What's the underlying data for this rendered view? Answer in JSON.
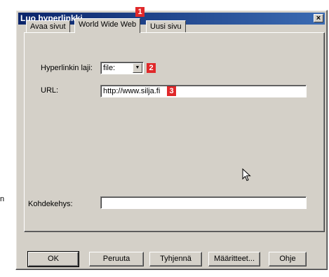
{
  "dialog": {
    "title": "Luo hyperlinkki",
    "close_glyph": "×"
  },
  "tabs": [
    {
      "label": "Avaa sivut",
      "active": false
    },
    {
      "label": "World Wide Web",
      "active": true
    },
    {
      "label": "Uusi sivu",
      "active": false
    }
  ],
  "form": {
    "hyperlink_type_label": "Hyperlinkin laji:",
    "hyperlink_type_value": "file:",
    "url_label": "URL:",
    "url_value": "http://www.silja.fi",
    "target_frame_label": "Kohdekehys:",
    "target_frame_value": ""
  },
  "callouts": [
    "1",
    "2",
    "3"
  ],
  "buttons": {
    "ok": "OK",
    "cancel": "Peruuta",
    "clear": "Tyhjennä",
    "properties": "Määritteet...",
    "help": "Ohje"
  },
  "edge_mark": "n",
  "colors": {
    "face": "#d4d0c8",
    "titlebar": "#0a246a",
    "callout": "#e0282a"
  }
}
